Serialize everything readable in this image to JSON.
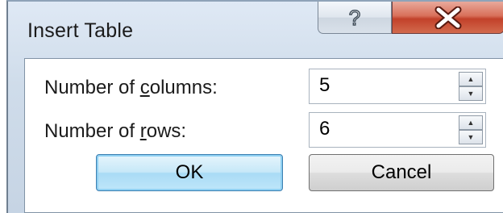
{
  "dialog": {
    "title": "Insert Table",
    "help_glyph": "?",
    "close_glyph": "✕"
  },
  "fields": {
    "columns": {
      "label_prefix": "Number of ",
      "label_mnemonic": "c",
      "label_suffix": "olumns:",
      "value": "5"
    },
    "rows": {
      "label_prefix": "Number of ",
      "label_mnemonic": "r",
      "label_suffix": "ows:",
      "value": "6"
    }
  },
  "buttons": {
    "ok_label": "OK",
    "cancel_label": "Cancel"
  },
  "spinner": {
    "up_glyph": "▲",
    "down_glyph": "▼"
  }
}
